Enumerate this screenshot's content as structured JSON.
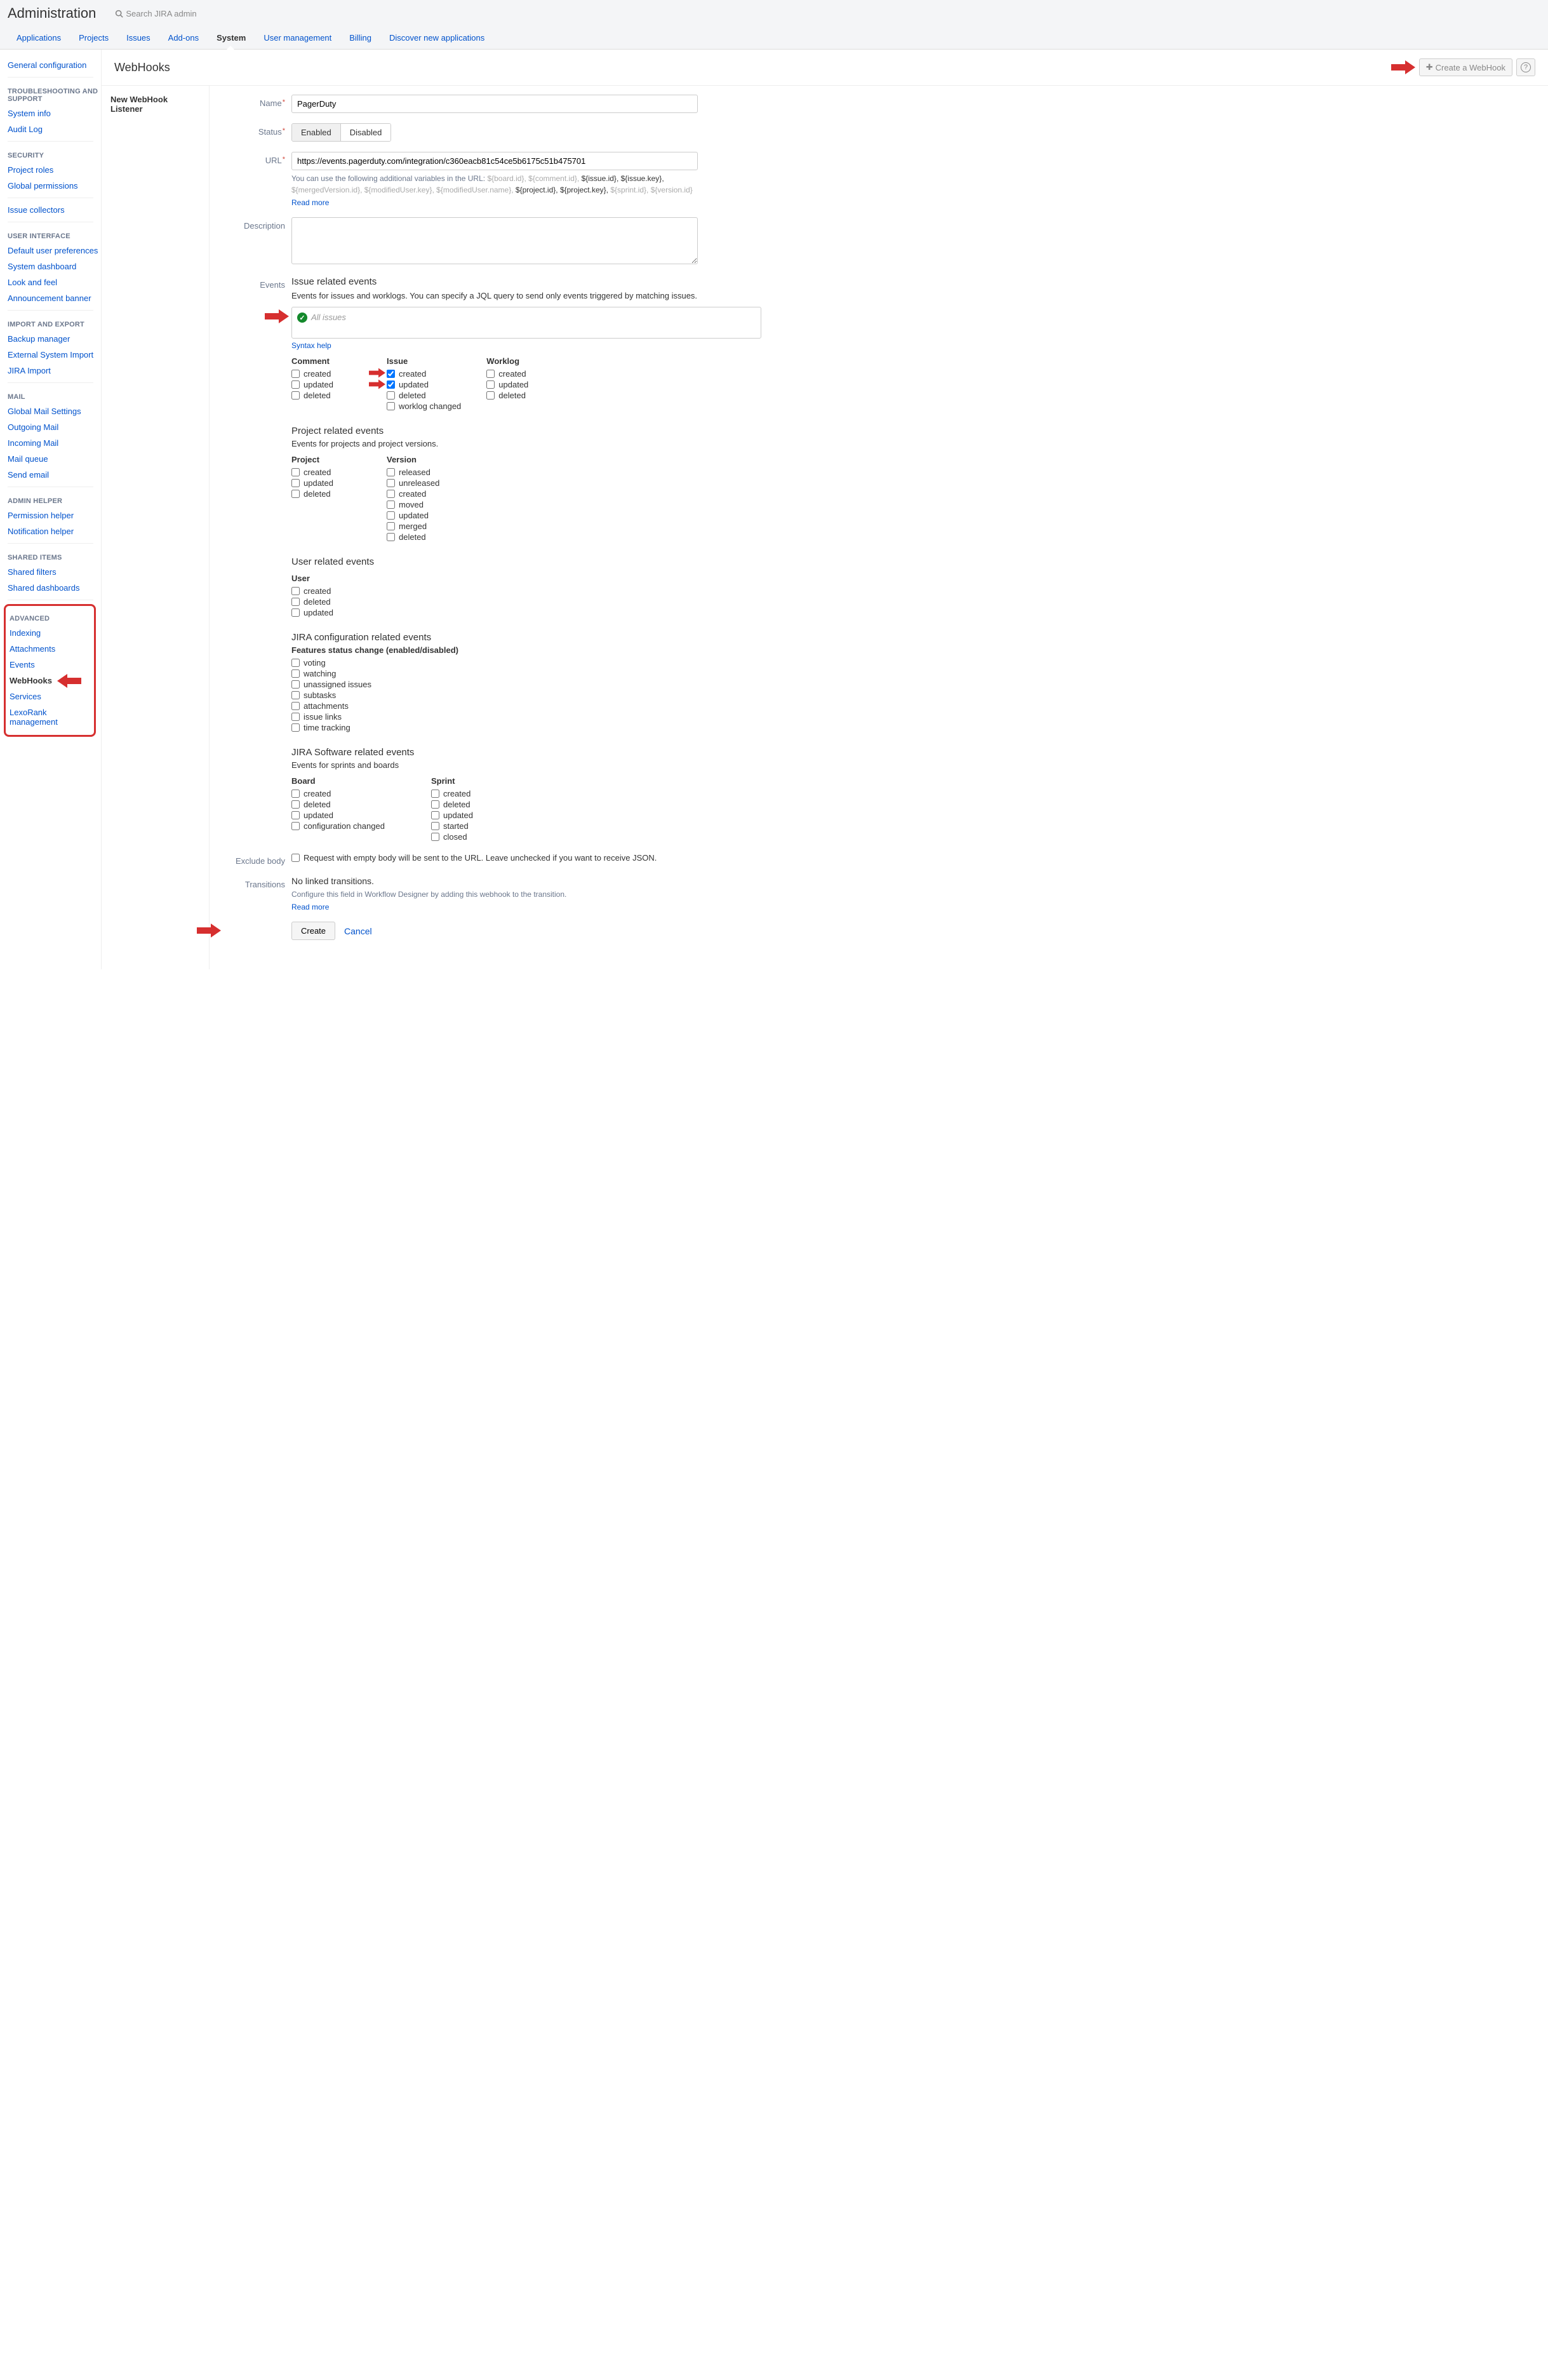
{
  "header": {
    "title": "Administration",
    "searchPlaceholder": "Search JIRA admin"
  },
  "tabs": [
    "Applications",
    "Projects",
    "Issues",
    "Add-ons",
    "System",
    "User management",
    "Billing",
    "Discover new applications"
  ],
  "activeTab": "System",
  "sidebar": {
    "topLink": "General configuration",
    "groups": [
      {
        "head": "TROUBLESHOOTING AND SUPPORT",
        "items": [
          "System info",
          "Audit Log"
        ]
      },
      {
        "head": "SECURITY",
        "items": [
          "Project roles",
          "Global permissions"
        ]
      },
      {
        "head": "",
        "items": [
          "Issue collectors"
        ]
      },
      {
        "head": "USER INTERFACE",
        "items": [
          "Default user preferences",
          "System dashboard",
          "Look and feel",
          "Announcement banner"
        ]
      },
      {
        "head": "IMPORT AND EXPORT",
        "items": [
          "Backup manager",
          "External System Import",
          "JIRA Import"
        ]
      },
      {
        "head": "MAIL",
        "items": [
          "Global Mail Settings",
          "Outgoing Mail",
          "Incoming Mail",
          "Mail queue",
          "Send email"
        ]
      },
      {
        "head": "ADMIN HELPER",
        "items": [
          "Permission helper",
          "Notification helper"
        ]
      },
      {
        "head": "SHARED ITEMS",
        "items": [
          "Shared filters",
          "Shared dashboards"
        ]
      }
    ],
    "advanced": {
      "head": "ADVANCED",
      "items": [
        "Indexing",
        "Attachments",
        "Events",
        "WebHooks",
        "Services",
        "LexoRank management"
      ],
      "current": "WebHooks"
    }
  },
  "page": {
    "title": "WebHooks",
    "createButton": "Create a WebHook",
    "listenerTitle": "New WebHook Listener"
  },
  "form": {
    "labels": {
      "name": "Name",
      "status": "Status",
      "url": "URL",
      "description": "Description",
      "events": "Events",
      "excludeBody": "Exclude body",
      "transitions": "Transitions"
    },
    "name": "PagerDuty",
    "status": {
      "enabled": "Enabled",
      "disabled": "Disabled",
      "active": "Enabled"
    },
    "url": "https://events.pagerduty.com/integration/c360eacb81c54ce5b6175c51b475701",
    "urlHelp": {
      "prefix": "You can use the following additional variables in the URL:",
      "muted1": "${board.id}, ${comment.id},",
      "active1": "${issue.id}, ${issue.key},",
      "muted2": "${mergedVersion.id}, ${modifiedUser.key}, ${modifiedUser.name},",
      "active2": "${project.id}, ${project.key},",
      "muted3": "${sprint.id}, ${version.id}",
      "readMore": "Read more"
    },
    "events": {
      "head": "Issue related events",
      "desc": "Events for issues and worklogs. You can specify a JQL query to send only events triggered by matching issues.",
      "jqlPlaceholder": "All issues",
      "syntaxHelp": "Syntax help",
      "columns": {
        "comment": {
          "label": "Comment",
          "items": [
            [
              "created",
              false
            ],
            [
              "updated",
              false
            ],
            [
              "deleted",
              false
            ]
          ]
        },
        "issue": {
          "label": "Issue",
          "items": [
            [
              "created",
              true
            ],
            [
              "updated",
              true
            ],
            [
              "deleted",
              false
            ],
            [
              "worklog changed",
              false
            ]
          ]
        },
        "worklog": {
          "label": "Worklog",
          "items": [
            [
              "created",
              false
            ],
            [
              "updated",
              false
            ],
            [
              "deleted",
              false
            ]
          ]
        }
      }
    },
    "projectEvents": {
      "head": "Project related events",
      "desc": "Events for projects and project versions.",
      "project": {
        "label": "Project",
        "items": [
          "created",
          "updated",
          "deleted"
        ]
      },
      "version": {
        "label": "Version",
        "items": [
          "released",
          "unreleased",
          "created",
          "moved",
          "updated",
          "merged",
          "deleted"
        ]
      }
    },
    "userEvents": {
      "head": "User related events",
      "user": {
        "label": "User",
        "items": [
          "created",
          "deleted",
          "updated"
        ]
      }
    },
    "configEvents": {
      "head": "JIRA configuration related events",
      "featHead": "Features status change (enabled/disabled)",
      "items": [
        "voting",
        "watching",
        "unassigned issues",
        "subtasks",
        "attachments",
        "issue links",
        "time tracking"
      ]
    },
    "softwareEvents": {
      "head": "JIRA Software related events",
      "desc": "Events for sprints and boards",
      "board": {
        "label": "Board",
        "items": [
          "created",
          "deleted",
          "updated",
          "configuration changed"
        ]
      },
      "sprint": {
        "label": "Sprint",
        "items": [
          "created",
          "deleted",
          "updated",
          "started",
          "closed"
        ]
      }
    },
    "excludeBody": "Request with empty body will be sent to the URL. Leave unchecked if you want to receive JSON.",
    "transitions": {
      "none": "No linked transitions.",
      "hint": "Configure this field in Workflow Designer by adding this webhook to the transition.",
      "readMore": "Read more"
    },
    "actions": {
      "create": "Create",
      "cancel": "Cancel"
    }
  }
}
